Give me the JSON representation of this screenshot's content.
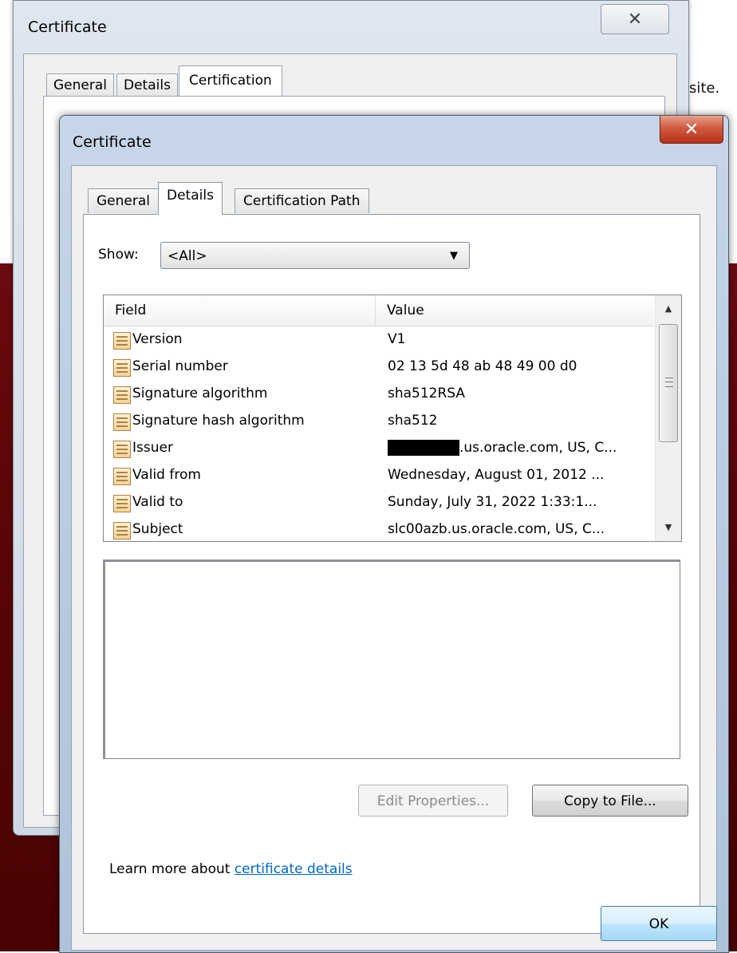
{
  "background": {
    "text_right_top": "site."
  },
  "back_dialog": {
    "title": "Certificate",
    "close_glyph": "✕",
    "tabs": [
      {
        "label": "General"
      },
      {
        "label": "Details"
      },
      {
        "label": "Certification Path"
      }
    ]
  },
  "dialog": {
    "title": "Certificate",
    "close_glyph": "✕",
    "tabs": [
      {
        "label": "General"
      },
      {
        "label": "Details"
      },
      {
        "label": "Certification Path"
      }
    ],
    "show_label": "Show:",
    "show_value": "<All>",
    "list": {
      "col_field": "Field",
      "col_value": "Value",
      "rows": [
        {
          "field": "Version",
          "value": "V1"
        },
        {
          "field": "Serial number",
          "value": "02 13 5d 48 ab 48 49 00 d0"
        },
        {
          "field": "Signature algorithm",
          "value": "sha512RSA"
        },
        {
          "field": "Signature hash algorithm",
          "value": "sha512"
        },
        {
          "field": "Issuer",
          "value": ".us.oracle.com, US, C..."
        },
        {
          "field": "Valid from",
          "value": "Wednesday, August 01, 2012 ..."
        },
        {
          "field": "Valid to",
          "value": "Sunday, July 31, 2022 1:33:1..."
        },
        {
          "field": "Subject",
          "value": "slc00azb.us.oracle.com, US, C..."
        }
      ]
    },
    "edit_properties_label": "Edit Properties...",
    "copy_to_file_label": "Copy to File...",
    "learn_more_prefix": "Learn more about ",
    "learn_more_link": "certificate details",
    "ok_label": "OK"
  },
  "colors": {
    "link": "#0066cc",
    "close_red": "#c1402a",
    "background_dark": "#5a0507"
  },
  "icons": {
    "field_row_icon": "certificate-field-icon",
    "dropdown_arrow": "▼",
    "scroll_up": "▲",
    "scroll_down": "▼"
  }
}
